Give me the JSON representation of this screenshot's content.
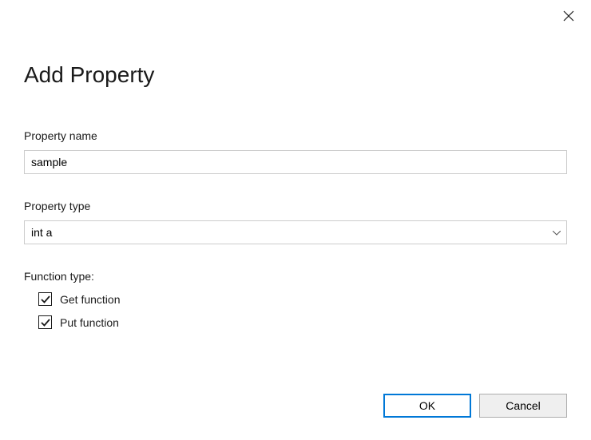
{
  "title": "Add Property",
  "fields": {
    "property_name": {
      "label": "Property name",
      "value": "sample"
    },
    "property_type": {
      "label": "Property type",
      "value": "int a"
    }
  },
  "function_type": {
    "label": "Function type:",
    "get": {
      "label": "Get function",
      "checked": true
    },
    "put": {
      "label": "Put function",
      "checked": true
    }
  },
  "buttons": {
    "ok": "OK",
    "cancel": "Cancel"
  }
}
